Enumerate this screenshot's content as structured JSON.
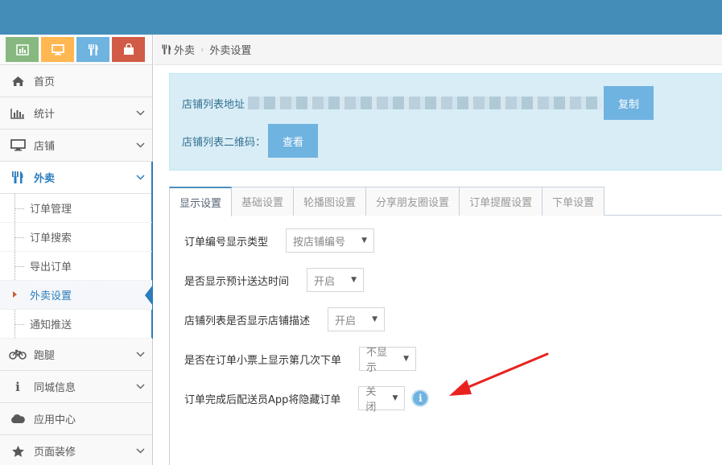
{
  "shortcuts": [
    {
      "name": "chart",
      "color": "#87b87f"
    },
    {
      "name": "desktop",
      "color": "#ffb752"
    },
    {
      "name": "cutlery",
      "color": "#6fb3e0"
    },
    {
      "name": "shopping-bag",
      "color": "#d15b47"
    }
  ],
  "sidebar": {
    "items": [
      {
        "label": "首页",
        "icon": "home-icon"
      },
      {
        "label": "统计",
        "icon": "bar-chart-icon"
      },
      {
        "label": "店铺",
        "icon": "desktop-icon"
      },
      {
        "label": "外卖",
        "icon": "cutlery-icon"
      },
      {
        "label": "跑腿",
        "icon": "bicycle-icon"
      },
      {
        "label": "同城信息",
        "icon": "info-icon"
      },
      {
        "label": "应用中心",
        "icon": "cloud-icon"
      },
      {
        "label": "页面装修",
        "icon": "star-icon"
      }
    ],
    "submenu": [
      "订单管理",
      "订单搜索",
      "导出订单",
      "外卖设置",
      "通知推送"
    ]
  },
  "breadcrumb": {
    "section": "外卖",
    "page": "外卖设置"
  },
  "store_url": {
    "label": "店铺列表地址",
    "copy_label": "复制",
    "qr_label": "店铺列表二维码：",
    "view_label": "查看"
  },
  "tabs": [
    "显示设置",
    "基础设置",
    "轮播图设置",
    "分享朋友圈设置",
    "订单提醒设置",
    "下单设置"
  ],
  "form": [
    {
      "label": "订单编号显示类型",
      "value": "按店铺编号"
    },
    {
      "label": "是否显示预计送达时间",
      "value": "开启"
    },
    {
      "label": "店铺列表是否显示店铺描述",
      "value": "开启"
    },
    {
      "label": "是否在订单小票上显示第几次下单",
      "value": "不显示"
    },
    {
      "label": "订单完成后配送员App将隐藏订单",
      "value": "关闭"
    }
  ],
  "colors": {
    "topbar": "#438eb9",
    "accent": "#2b7dbc",
    "button": "#6fb3e0",
    "annotation_arrow": "#e8231f"
  }
}
